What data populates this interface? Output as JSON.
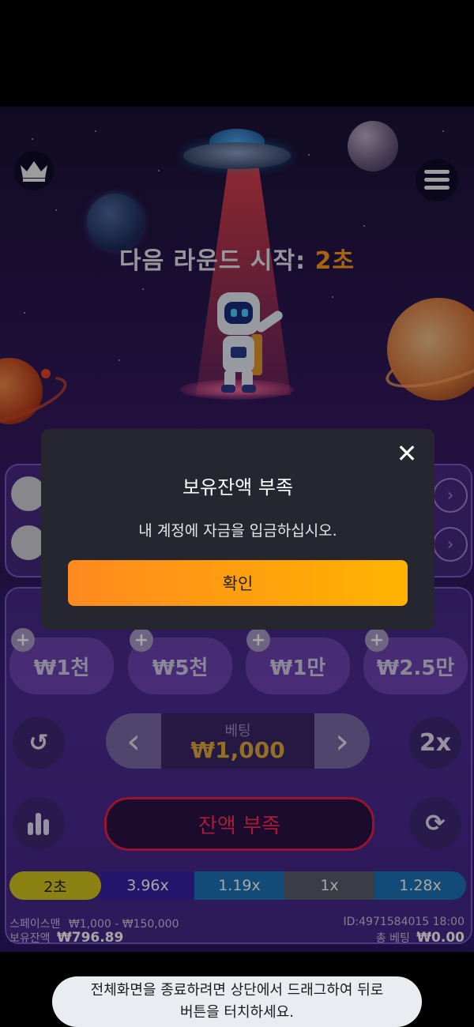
{
  "round": {
    "prefix": "다음 라운드 시작:",
    "countdown": "2초"
  },
  "icons": {
    "crown": "crown-icon",
    "menu": "hamburger-menu-icon"
  },
  "chips": [
    {
      "label": "₩1천"
    },
    {
      "label": "₩5천"
    },
    {
      "label": "₩1만"
    },
    {
      "label": "₩2.5만"
    }
  ],
  "chip_plus": "+",
  "bet": {
    "label": "베팅",
    "value": "₩1,000",
    "prev": "‹",
    "next": "›"
  },
  "side": {
    "undo": "↺",
    "double": "2x",
    "stats": "stats-icon",
    "auto": "⟳"
  },
  "main_button": {
    "label": "잔액 부족"
  },
  "history": [
    {
      "label": "2초",
      "color": "#d7c71e",
      "text_color": "#222222"
    },
    {
      "label": "3.96x",
      "color": "#3a22a8",
      "text_color": "#ffffff"
    },
    {
      "label": "1.19x",
      "color": "#1e74b8",
      "text_color": "#ffffff"
    },
    {
      "label": "1x",
      "color": "#5a5f6a",
      "text_color": "#ffffff"
    },
    {
      "label": "1.28x",
      "color": "#1e74b8",
      "text_color": "#ffffff"
    }
  ],
  "footer": {
    "game_name": "스페이스맨",
    "limits": "₩1,000 - ₩150,000",
    "balance_label": "보유잔액",
    "balance_value": "₩796.89",
    "id_time": "ID:4971584015 18:00",
    "total_bet_label": "총 베팅",
    "total_bet_value": "₩0.00"
  },
  "modal": {
    "title": "보유잔액 부족",
    "message": "내 계정에 자금을 입금하십시오.",
    "confirm": "확인",
    "close": "✕"
  },
  "toast": {
    "line1": "전체화면을 종료하려면 상단에서 드래그하여 뒤로",
    "line2": "버튼을 터치하세요."
  },
  "colors": {
    "accent": "#ff9a1a",
    "danger": "#ff2a52",
    "confirm_start": "#ff8a1f",
    "confirm_end": "#ffb300"
  }
}
